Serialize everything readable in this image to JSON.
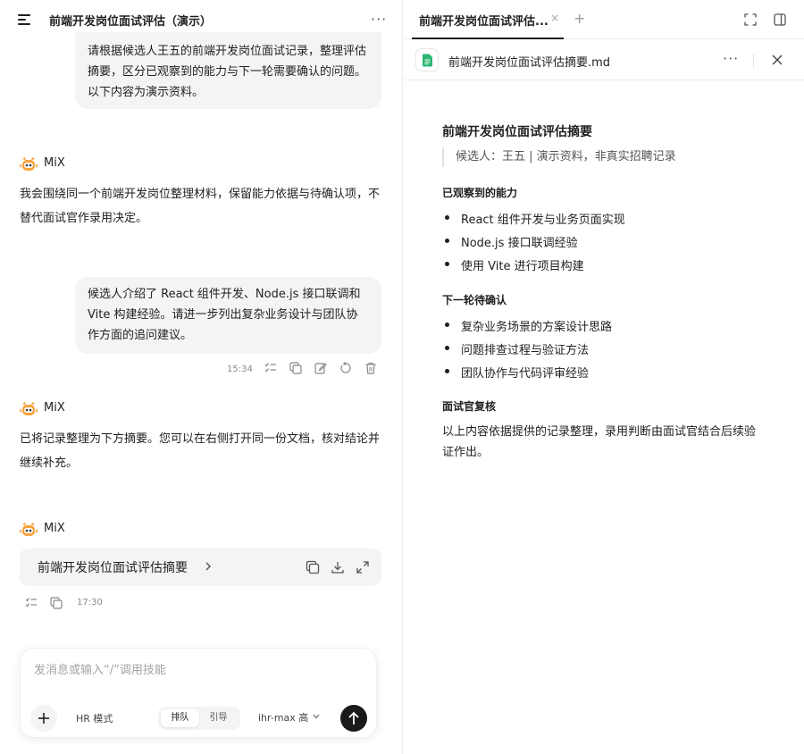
{
  "conversation": {
    "title": "前端开发岗位面试评估（演示）",
    "user_message_1": "请根据候选人王五的前端开发岗位面试记录，整理评估摘要，区分已观察到的能力与下一轮需要确认的问题。以下内容为演示资料。",
    "assistant_name": "MiX",
    "assistant_message_1": "我会围绕同一个前端开发岗位整理材料，保留能力依据与待确认项，不替代面试官作录用决定。",
    "user_message_2": "候选人介绍了 React 组件开发、Node.js 接口联调和 Vite 构建经验。请进一步列出复杂业务设计与团队协作方面的追问建议。",
    "user_message_2_time": "15:34",
    "assistant_message_2": "已将记录整理为下方摘要。您可以在右侧打开同一份文档，核对结论并继续补充。",
    "doc_card_title": "前端开发岗位面试评估摘要",
    "doc_card_time": "17:30"
  },
  "composer": {
    "placeholder": "发消息或输入“/”调用技能",
    "mode_label": "HR 模式",
    "segment_options": [
      "排队",
      "引导"
    ],
    "segment_selected": "排队",
    "model_label": "ihr-max 高"
  },
  "right_panel": {
    "tab_label": "前端开发岗位面试评估...",
    "file_name": "前端开发岗位面试评估摘要.md",
    "doc": {
      "title": "前端开发岗位面试评估摘要",
      "quote": "候选人：王五 | 演示资料，非真实招聘记录",
      "section1_title": "已观察到的能力",
      "section1_items": [
        "React 组件开发与业务页面实现",
        "Node.js 接口联调经验",
        "使用 Vite 进行项目构建"
      ],
      "section2_title": "下一轮待确认",
      "section2_items": [
        "复杂业务场景的方案设计思路",
        "问题排查过程与验证方法",
        "团队协作与代码评审经验"
      ],
      "section3_title": "面试官复核",
      "section3_text": "以上内容依据提供的记录整理，录用判断由面试官结合后续验证作出。"
    }
  },
  "colors": {
    "bubble_bg": "#f3f4f6",
    "send_button": "#1a1a1a",
    "file_icon_green": "#2bb673",
    "avatar_orange": "#f39b2f"
  },
  "icons": {
    "menu": "menu-icon",
    "more": "more-icon",
    "file": "markdown-file-icon",
    "copy": "copy-icon",
    "download": "download-icon",
    "expand": "expand-icon",
    "send": "arrow-up-icon"
  }
}
